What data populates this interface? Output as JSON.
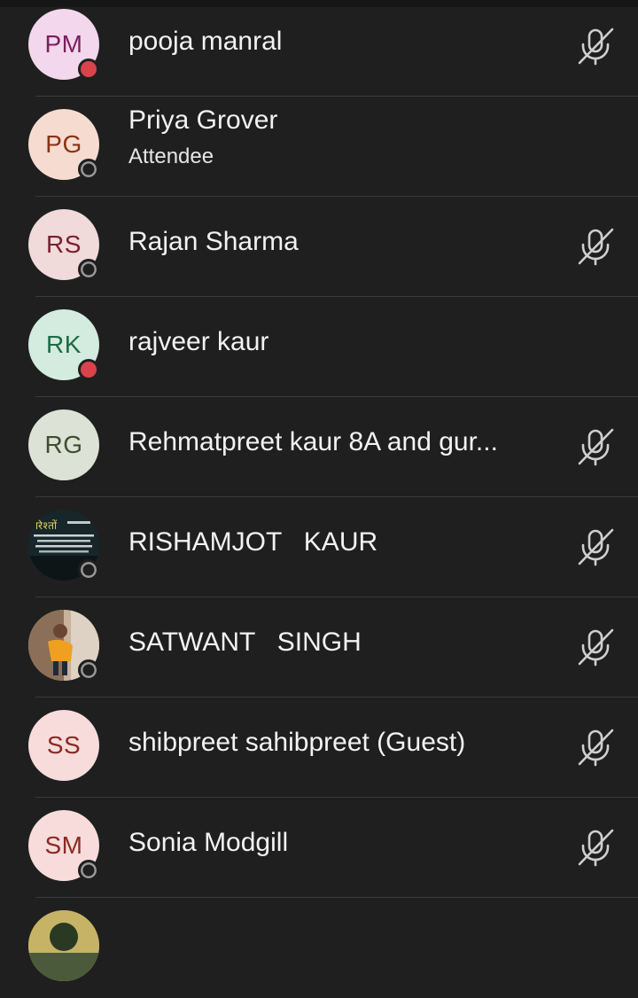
{
  "participants": [
    {
      "initials": "PM",
      "name": "pooja manral",
      "subtitle": "",
      "avatar_bg": "#f3d7ec",
      "avatar_fg": "#7a1f5e",
      "status": "busy",
      "muted": true,
      "icon": "mic-off-icon"
    },
    {
      "initials": "PG",
      "name": "Priya Grover",
      "subtitle": "Attendee",
      "avatar_bg": "#f6dcd0",
      "avatar_fg": "#8a3214",
      "status": "offline",
      "muted": false
    },
    {
      "initials": "RS",
      "name": "Rajan Sharma",
      "subtitle": "",
      "avatar_bg": "#f0dada",
      "avatar_fg": "#7a1f2e",
      "status": "offline",
      "muted": true,
      "icon": "mic-off-icon"
    },
    {
      "initials": "RK",
      "name": "rajveer kaur",
      "subtitle": "",
      "avatar_bg": "#d3ecdf",
      "avatar_fg": "#1f6a45",
      "status": "busy",
      "muted": false
    },
    {
      "initials": "RG",
      "name": "Rehmatpreet kaur 8A and gur...",
      "subtitle": "",
      "avatar_bg": "#dde2d6",
      "avatar_fg": "#3f4d2e",
      "status": "none",
      "muted": true,
      "icon": "mic-off-icon"
    },
    {
      "initials": "",
      "name": "RISHAMJOT   KAUR",
      "subtitle": "",
      "avatar_bg": "#1b2b2e",
      "avatar_fg": "#ffffff",
      "status": "offline",
      "muted": true,
      "photo": "text-poster-photo",
      "icon": "mic-off-icon"
    },
    {
      "initials": "",
      "name": "SATWANT   SINGH",
      "subtitle": "",
      "avatar_bg": "#b8a08a",
      "avatar_fg": "#ffffff",
      "status": "offline",
      "muted": true,
      "photo": "child-photo",
      "icon": "mic-off-icon"
    },
    {
      "initials": "SS",
      "name": "shibpreet sahibpreet (Guest)",
      "subtitle": "",
      "avatar_bg": "#f8dcdc",
      "avatar_fg": "#8a2a22",
      "status": "none",
      "muted": true,
      "icon": "mic-off-icon"
    },
    {
      "initials": "SM",
      "name": "Sonia Modgill",
      "subtitle": "",
      "avatar_bg": "#f8dcdc",
      "avatar_fg": "#8a2a22",
      "status": "offline",
      "muted": true,
      "icon": "mic-off-icon"
    },
    {
      "initials": "",
      "name": "",
      "subtitle": "",
      "avatar_bg": "#c9b56a",
      "avatar_fg": "#ffffff",
      "status": "none",
      "muted": false,
      "photo": "partial-photo"
    }
  ]
}
